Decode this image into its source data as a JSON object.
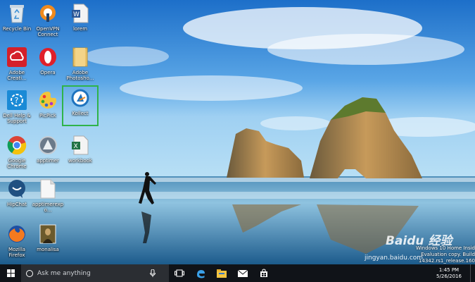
{
  "desktop": {
    "icons": [
      {
        "label": "Recycle Bin",
        "icon": "recycle-bin-icon"
      },
      {
        "label": "OpenVPN Connect",
        "icon": "openvpn-icon"
      },
      {
        "label": "lorem",
        "icon": "word-document-icon"
      },
      {
        "label": "Adobe Creati...",
        "icon": "adobe-creative-cloud-icon"
      },
      {
        "label": "Opera",
        "icon": "opera-icon"
      },
      {
        "label": "Adobe Photosho...",
        "icon": "folder-icon"
      },
      {
        "label": "Dell Help & Support",
        "icon": "dell-help-icon"
      },
      {
        "label": "PicPick",
        "icon": "picpick-icon"
      },
      {
        "label": "Kollect",
        "icon": "kollect-icon"
      },
      {
        "label": "Google Chrome",
        "icon": "chrome-icon"
      },
      {
        "label": "apptimer",
        "icon": "apptimer-icon"
      },
      {
        "label": "workbook",
        "icon": "excel-workbook-icon"
      },
      {
        "label": "HipChat",
        "icon": "hipchat-icon"
      },
      {
        "label": "apptimerexpo...",
        "icon": "blank-file-icon"
      },
      {
        "label": "Mozilla Firefox",
        "icon": "firefox-icon"
      },
      {
        "label": "monalisa",
        "icon": "image-file-icon"
      }
    ],
    "selected_icon": "Kollect"
  },
  "taskbar": {
    "search_placeholder": "Ask me anything",
    "apps": [
      "task-view-icon",
      "edge-icon",
      "file-explorer-icon",
      "mail-icon",
      "store-icon"
    ]
  },
  "tray": {
    "time": "1:45 PM",
    "date": "5/26/2016"
  },
  "evaluation": {
    "line1": "Windows 10 Home Insid",
    "line2": "Evaluation copy. Build 14342.rs1_release.160"
  },
  "watermark": {
    "logo": "Baidu 经验",
    "site": "jingyan.baidu.com"
  },
  "colors": {
    "taskbar": "#101318",
    "search_box": "#2b2e33",
    "selection": "#2fb34a"
  }
}
